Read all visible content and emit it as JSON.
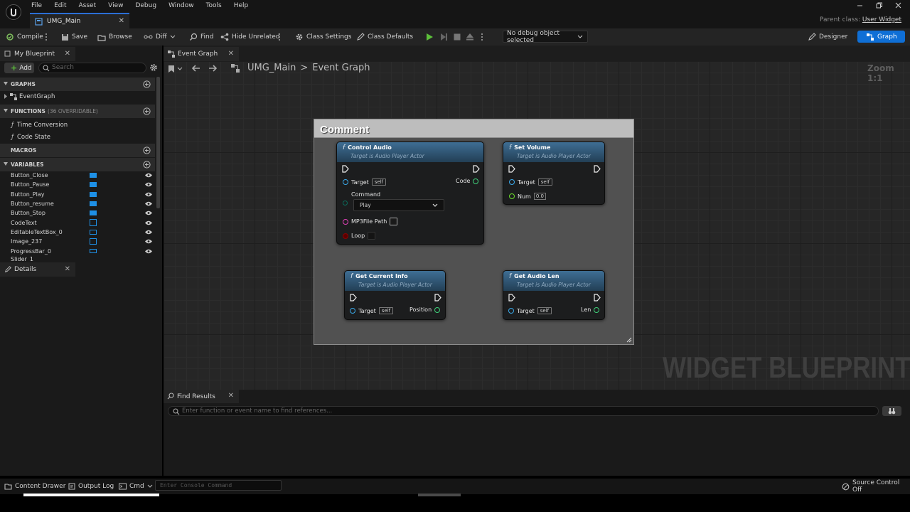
{
  "window": {
    "menu": [
      "File",
      "Edit",
      "Asset",
      "View",
      "Debug",
      "Window",
      "Tools",
      "Help"
    ],
    "document_tab": "UMG_Main",
    "parent_class_label": "Parent class:",
    "parent_class_value": "User Widget"
  },
  "toolbar": {
    "compile": "Compile",
    "save": "Save",
    "browse": "Browse",
    "diff": "Diff",
    "find": "Find",
    "hide_unrelated": "Hide Unrelated",
    "class_settings": "Class Settings",
    "class_defaults": "Class Defaults",
    "debug_object": "No debug object selected",
    "designer": "Designer",
    "graph": "Graph"
  },
  "my_blueprint": {
    "tab": "My Blueprint",
    "add": "Add",
    "search_placeholder": "Search",
    "graphs_header": "GRAPHS",
    "event_graph": "EventGraph",
    "functions_header": "FUNCTIONS",
    "functions_sub": "(36 OVERRIDABLE)",
    "functions": [
      "Time Conversion",
      "Code State"
    ],
    "macros_header": "MACROS",
    "variables_header": "VARIABLES",
    "variables": [
      "Button_Close",
      "Button_Pause",
      "Button_Play",
      "Button_resume",
      "Button_Stop",
      "CodeText",
      "EditableTextBox_0",
      "Image_237",
      "ProgressBar_0",
      "Slider_1"
    ]
  },
  "details": {
    "tab": "Details"
  },
  "graph": {
    "tab": "Event Graph",
    "breadcrumb_root": "UMG_Main",
    "breadcrumb_sep": ">",
    "breadcrumb_leaf": "Event Graph",
    "zoom": "Zoom 1:1",
    "watermark": "WIDGET BLUEPRINT",
    "comment_title": "Comment",
    "function_glyph": "f",
    "target_text": "Target is Audio Player Actor",
    "nodes": {
      "control_audio": {
        "title": "Control Audio",
        "target": "Target",
        "self": "self",
        "code": "Code",
        "command_label": "Command",
        "command_value": "Play",
        "mp3_path": "MP3File Path",
        "loop": "Loop"
      },
      "set_volume": {
        "title": "Set Volume",
        "target": "Target",
        "self": "self",
        "num": "Num",
        "num_value": "0.0"
      },
      "get_current_info": {
        "title": "Get Current Info",
        "target": "Target",
        "self": "self",
        "position": "Position"
      },
      "get_audio_len": {
        "title": "Get Audio Len",
        "target": "Target",
        "self": "self",
        "len": "Len"
      }
    }
  },
  "find_results": {
    "tab": "Find Results",
    "placeholder": "Enter function or event name to find references..."
  },
  "statusbar": {
    "content_drawer": "Content Drawer",
    "output_log": "Output Log",
    "cmd": "Cmd",
    "console_placeholder": "Enter Console Command",
    "source_control": "Source Control Off"
  }
}
